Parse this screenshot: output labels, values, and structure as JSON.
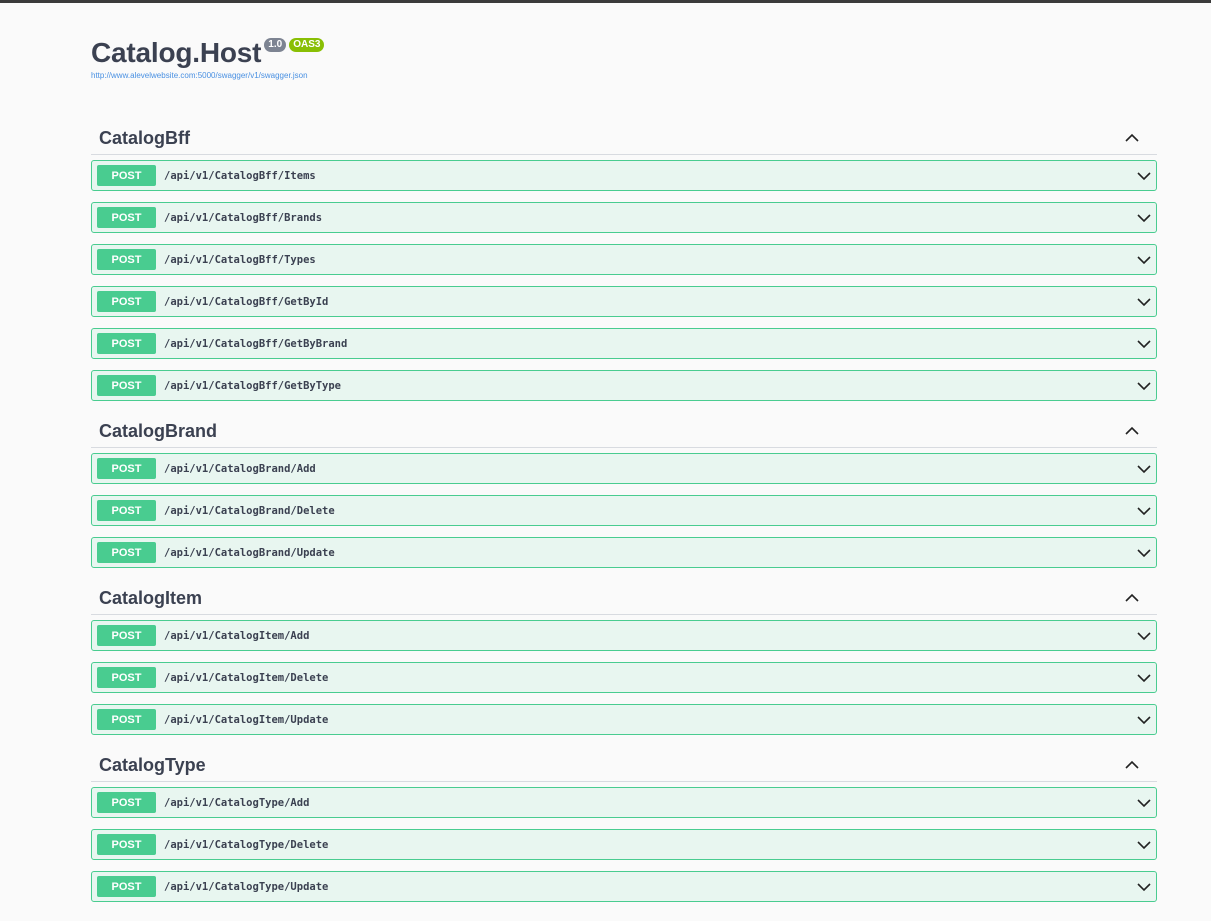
{
  "info": {
    "title": "Catalog.Host",
    "version_badge": "1.0",
    "oas_badge": "OAS3",
    "spec_url": "http://www.alevelwebsite.com:5000/swagger/v1/swagger.json"
  },
  "tags": [
    {
      "name": "CatalogBff",
      "operations": [
        {
          "method": "POST",
          "path": "/api/v1/CatalogBff/Items"
        },
        {
          "method": "POST",
          "path": "/api/v1/CatalogBff/Brands"
        },
        {
          "method": "POST",
          "path": "/api/v1/CatalogBff/Types"
        },
        {
          "method": "POST",
          "path": "/api/v1/CatalogBff/GetById"
        },
        {
          "method": "POST",
          "path": "/api/v1/CatalogBff/GetByBrand"
        },
        {
          "method": "POST",
          "path": "/api/v1/CatalogBff/GetByType"
        }
      ]
    },
    {
      "name": "CatalogBrand",
      "operations": [
        {
          "method": "POST",
          "path": "/api/v1/CatalogBrand/Add"
        },
        {
          "method": "POST",
          "path": "/api/v1/CatalogBrand/Delete"
        },
        {
          "method": "POST",
          "path": "/api/v1/CatalogBrand/Update"
        }
      ]
    },
    {
      "name": "CatalogItem",
      "operations": [
        {
          "method": "POST",
          "path": "/api/v1/CatalogItem/Add"
        },
        {
          "method": "POST",
          "path": "/api/v1/CatalogItem/Delete"
        },
        {
          "method": "POST",
          "path": "/api/v1/CatalogItem/Update"
        }
      ]
    },
    {
      "name": "CatalogType",
      "operations": [
        {
          "method": "POST",
          "path": "/api/v1/CatalogType/Add"
        },
        {
          "method": "POST",
          "path": "/api/v1/CatalogType/Delete"
        },
        {
          "method": "POST",
          "path": "/api/v1/CatalogType/Update"
        }
      ]
    }
  ],
  "colors": {
    "post_method": "#49cc90",
    "post_background": "#e8f6f0",
    "version_badge": "#7d8492",
    "oas_badge": "#89bf04",
    "link": "#4990e2"
  },
  "icons": {
    "section_toggle": "chevron-up-icon",
    "operation_toggle": "chevron-down-icon"
  }
}
